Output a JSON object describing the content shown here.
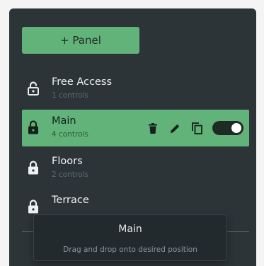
{
  "toolbar": {
    "add_panel_label": "+ Panel"
  },
  "panels": [
    {
      "name": "Free Access",
      "subtitle": "1 controls",
      "icon": "lock-open-icon",
      "selected": false
    },
    {
      "name": "Main",
      "subtitle": "4 controls",
      "icon": "lock-closed-icon",
      "selected": true,
      "enabled": true
    },
    {
      "name": "Floors",
      "subtitle": "2 controls",
      "icon": "lock-closed-icon",
      "selected": false
    },
    {
      "name": "Terrace",
      "subtitle": "",
      "icon": "lock-closed-icon",
      "selected": false
    }
  ],
  "row_actions": [
    "delete-icon",
    "edit-icon",
    "copy-icon",
    "toggle-switch"
  ],
  "tooltip": {
    "title": "Main",
    "message": "Drag and drop onto desired position"
  },
  "colors": {
    "background": "#2c3438",
    "accent": "#62b37a",
    "tooltip_background": "#222a2e"
  }
}
